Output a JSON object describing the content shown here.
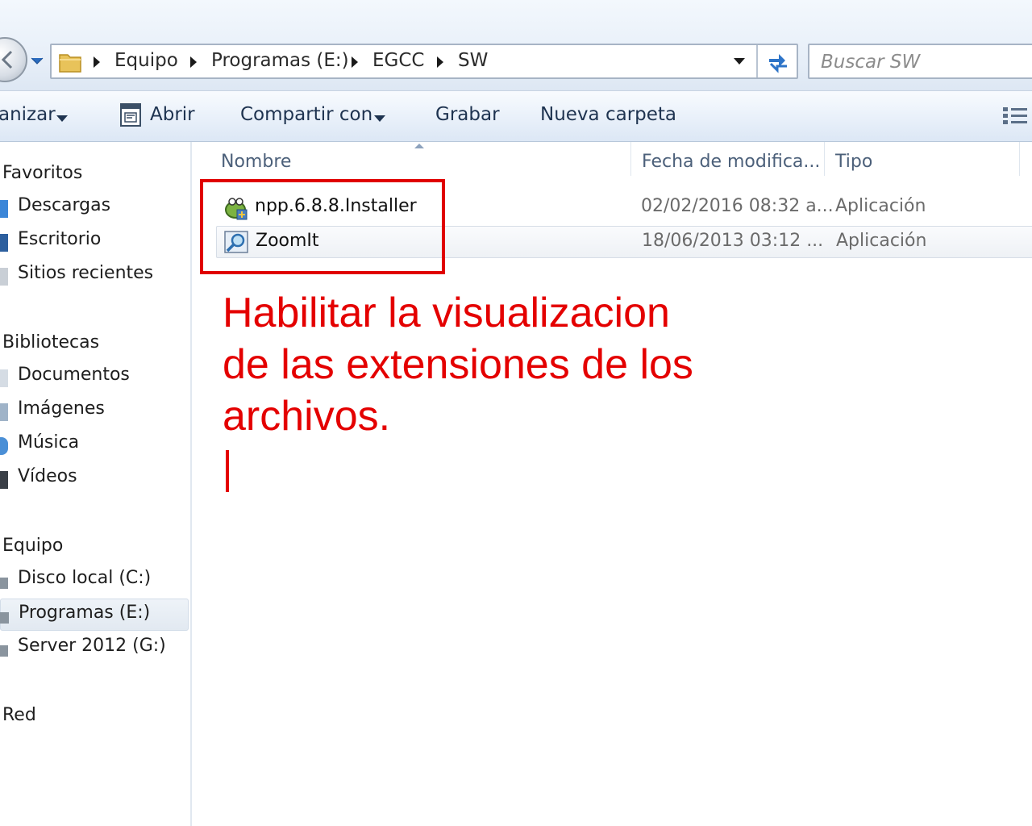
{
  "address_bar": {
    "breadcrumbs": [
      "Equipo",
      "Programas (E:)",
      "EGCC",
      "SW"
    ]
  },
  "search": {
    "placeholder": "Buscar SW"
  },
  "toolbar": {
    "organize_label": "anizar",
    "open_label": "Abrir",
    "share_label": "Compartir con",
    "burn_label": "Grabar",
    "new_folder_label": "Nueva carpeta"
  },
  "navigation": {
    "favorites": {
      "heading": "Favoritos",
      "items": [
        "Descargas",
        "Escritorio",
        "Sitios recientes"
      ]
    },
    "libraries": {
      "heading": "Bibliotecas",
      "items": [
        "Documentos",
        "Imágenes",
        "Música",
        "Vídeos"
      ]
    },
    "computer": {
      "heading": "Equipo",
      "items": [
        "Disco local (C:)",
        "Programas (E:)",
        "Server 2012 (G:)"
      ],
      "selected_item": "Programas (E:)"
    },
    "network": {
      "heading": "Red"
    }
  },
  "file_list": {
    "columns": [
      "Nombre",
      "Fecha de modifica...",
      "Tipo"
    ],
    "files": [
      {
        "name": "npp.6.8.8.Installer",
        "date": "02/02/2016 08:32 a...",
        "type": "Aplicación",
        "icon": "notepad-plus-plus-icon"
      },
      {
        "name": "ZoomIt",
        "date": "18/06/2013 03:12 ...",
        "type": "Aplicación",
        "icon": "zoomit-magnifier-icon"
      }
    ]
  },
  "annotation": {
    "lines": [
      "Habilitar la visualizacion",
      "de las extensiones de los",
      "archivos."
    ],
    "color": "#e40000"
  }
}
